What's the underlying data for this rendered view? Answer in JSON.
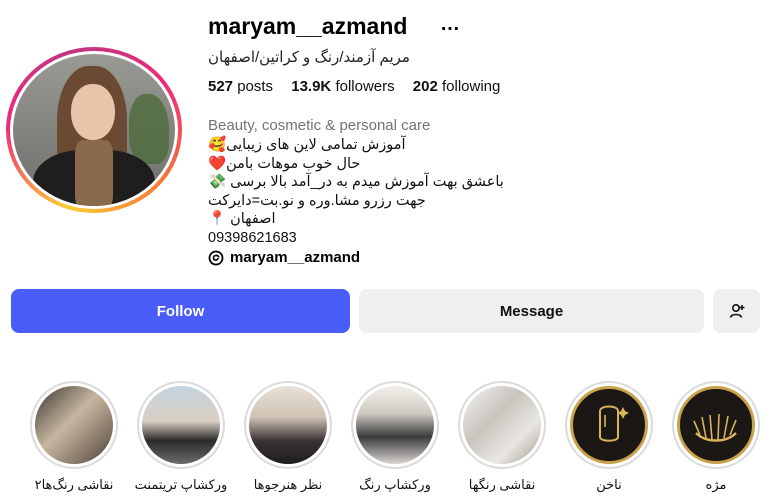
{
  "profile": {
    "username": "maryam__azmand",
    "more_icon": "…",
    "full_name": "مریم آزمند/رنگ و کراتین/اصفهان",
    "stats": {
      "posts_num": "527",
      "posts_label": "posts",
      "followers_num": "13.9K",
      "followers_label": "followers",
      "following_num": "202",
      "following_label": "following"
    },
    "category": "Beauty, cosmetic & personal care",
    "bio": [
      "🥰آموزش تمامی لاین های زیبایی",
      "❤️حال خوب موهات بامن",
      "💸 باعشق بهت آموزش میدم به در_آمد بالا برسی",
      "جهت رزرو مشا.وره و نو.بت=دایرکت",
      "📍 اصفهان",
      "09398621683"
    ],
    "threads_handle": "maryam__azmand"
  },
  "actions": {
    "follow_label": "Follow",
    "message_label": "Message",
    "add_user_icon": "person-add-icon"
  },
  "highlights": [
    {
      "label": "نقاشی رنگ‌ها۲"
    },
    {
      "label": "ورکشاپ تریتمنت"
    },
    {
      "label": "نظر هنرجوها"
    },
    {
      "label": "ورکشاپ رنگ"
    },
    {
      "label": "نقاشی رنگها"
    },
    {
      "label": "ناخن"
    },
    {
      "label": "مژه"
    }
  ],
  "colors": {
    "follow": "#4a5df9",
    "secondary": "#efeff1",
    "muted": "#737373"
  }
}
